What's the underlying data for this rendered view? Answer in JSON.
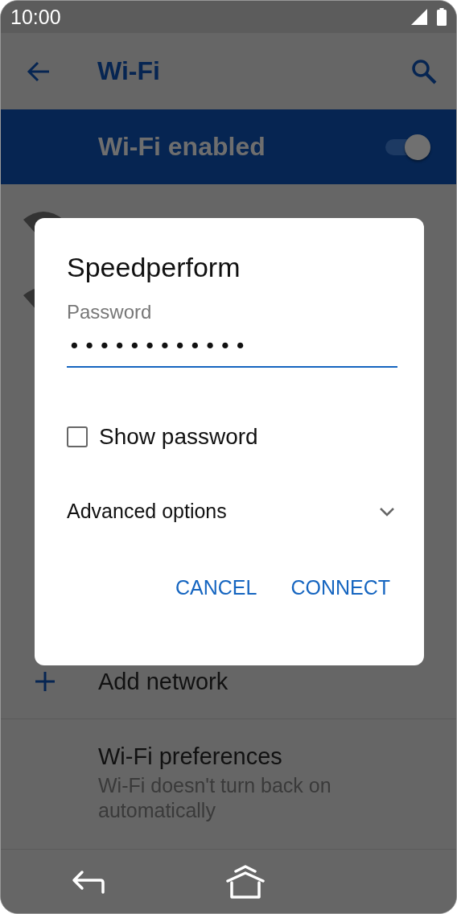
{
  "status_bar": {
    "time": "10:00"
  },
  "toolbar": {
    "title": "Wi-Fi"
  },
  "wifi_toggle": {
    "label": "Wi-Fi enabled",
    "on": true
  },
  "add_network": {
    "label": "Add network"
  },
  "preferences": {
    "title": "Wi-Fi preferences",
    "summary": "Wi-Fi doesn't turn back on automatically"
  },
  "dialog": {
    "title": "Speedperform",
    "password": {
      "label": "Password",
      "value": "••••••••••••"
    },
    "show_password": {
      "label": "Show password",
      "checked": false
    },
    "advanced": {
      "label": "Advanced options",
      "expanded": false
    },
    "buttons": [
      "CANCEL",
      "CONNECT"
    ]
  }
}
